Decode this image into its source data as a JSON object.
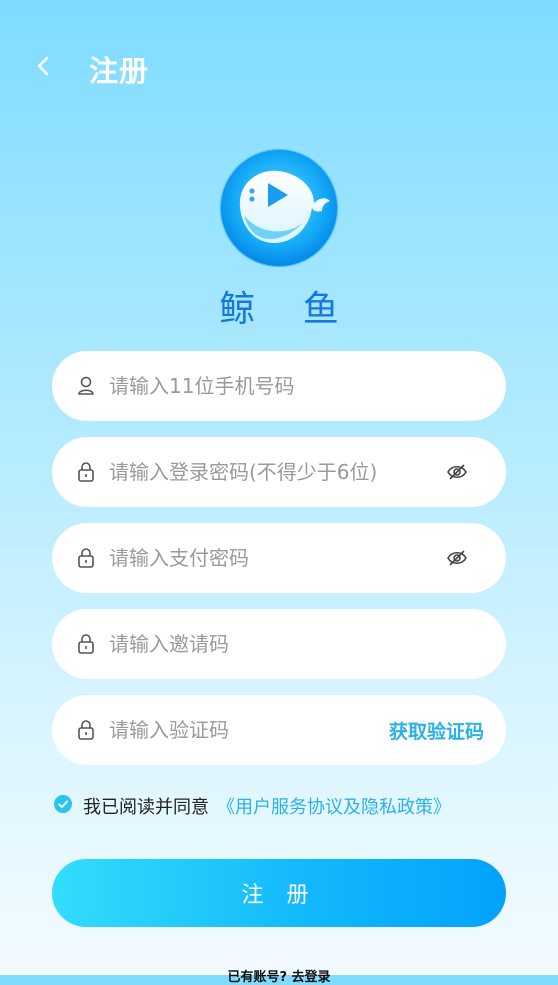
{
  "header": {
    "title": "注册"
  },
  "brand": {
    "name": "鲸 鱼"
  },
  "form": {
    "phone_placeholder": "请输入11位手机号码",
    "password_placeholder": "请输入登录密码(不得少于6位)",
    "pay_password_placeholder": "请输入支付密码",
    "invite_placeholder": "请输入邀请码",
    "code_placeholder": "请输入验证码",
    "get_code_label": "获取验证码"
  },
  "agreement": {
    "prefix": "我已阅读并同意",
    "link": "《用户服务协议及隐私政策》",
    "checked": true
  },
  "submit_label": "注 册",
  "login_hint": "已有账号? 去登录",
  "colors": {
    "primary": "#2ab2e8",
    "brand_text": "#1777e0",
    "button_start": "#33ddfb",
    "button_end": "#02a2fc"
  }
}
